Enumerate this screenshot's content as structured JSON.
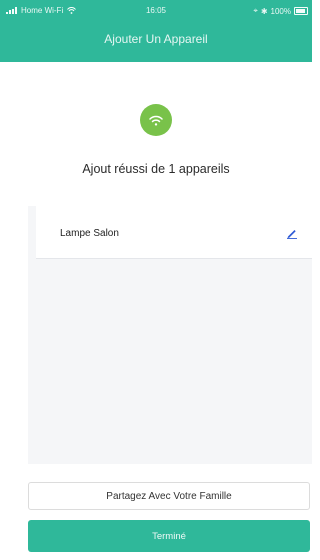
{
  "status_bar": {
    "carrier": "Home Wi-Fi",
    "time": "16:05",
    "battery": "100%"
  },
  "header": {
    "title": "Ajouter Un Appareil"
  },
  "success": {
    "icon": "wifi-icon",
    "message": "Ajout réussi de 1 appareils"
  },
  "devices": [
    {
      "name": "Lampe Salon",
      "action_icon": "edit-icon"
    }
  ],
  "actions": {
    "share_label": "Partagez Avec Votre Famille",
    "done_label": "Terminé"
  },
  "colors": {
    "accent": "#2fb89a",
    "success": "#79c24a",
    "edit": "#2f5bd6"
  }
}
